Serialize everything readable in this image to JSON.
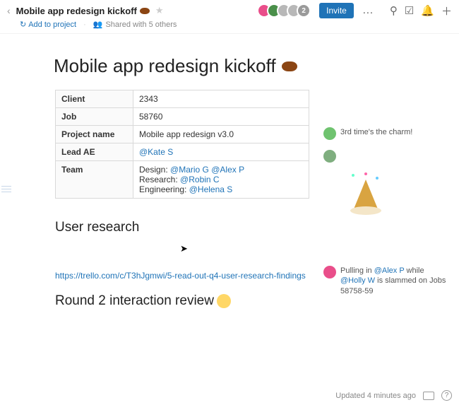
{
  "header": {
    "doc_title_small": "Mobile app redesign kickoff",
    "add_to_project": "Add to project",
    "shared_with": "Shared with 5 others",
    "invite_label": "Invite",
    "avatar_extra_count": "2"
  },
  "title": "Mobile app redesign kickoff",
  "info_table": {
    "rows": [
      {
        "k": "Client",
        "v": "2343"
      },
      {
        "k": "Job",
        "v": "58760"
      },
      {
        "k": "Project name",
        "v": "Mobile app redesign v3.0"
      },
      {
        "k": "Lead AE",
        "mention": "@Kate S"
      }
    ],
    "team_label": "Team",
    "team": {
      "design_label": "Design:",
      "design_m1": "@Mario G",
      "design_m2": "@Alex P",
      "research_label": "Research:",
      "research_m1": "@Robin C",
      "eng_label": "Engineering:",
      "eng_m1": "@Helena S"
    }
  },
  "sections": {
    "user_research": "User research",
    "round2": "Round 2 interaction review"
  },
  "link": "https://trello.com/c/T3hJgmwi/5-read-out-q4-user-research-findings",
  "comments": {
    "c1": "3rd time's the charm!",
    "c2_pre": "Pulling in ",
    "c2_mention1": "@Alex P",
    "c2_mid": " while ",
    "c2_mention2": "@Holly W",
    "c2_post": " is slammed on Jobs 58758-59"
  },
  "footer": {
    "updated": "Updated 4 minutes ago"
  }
}
